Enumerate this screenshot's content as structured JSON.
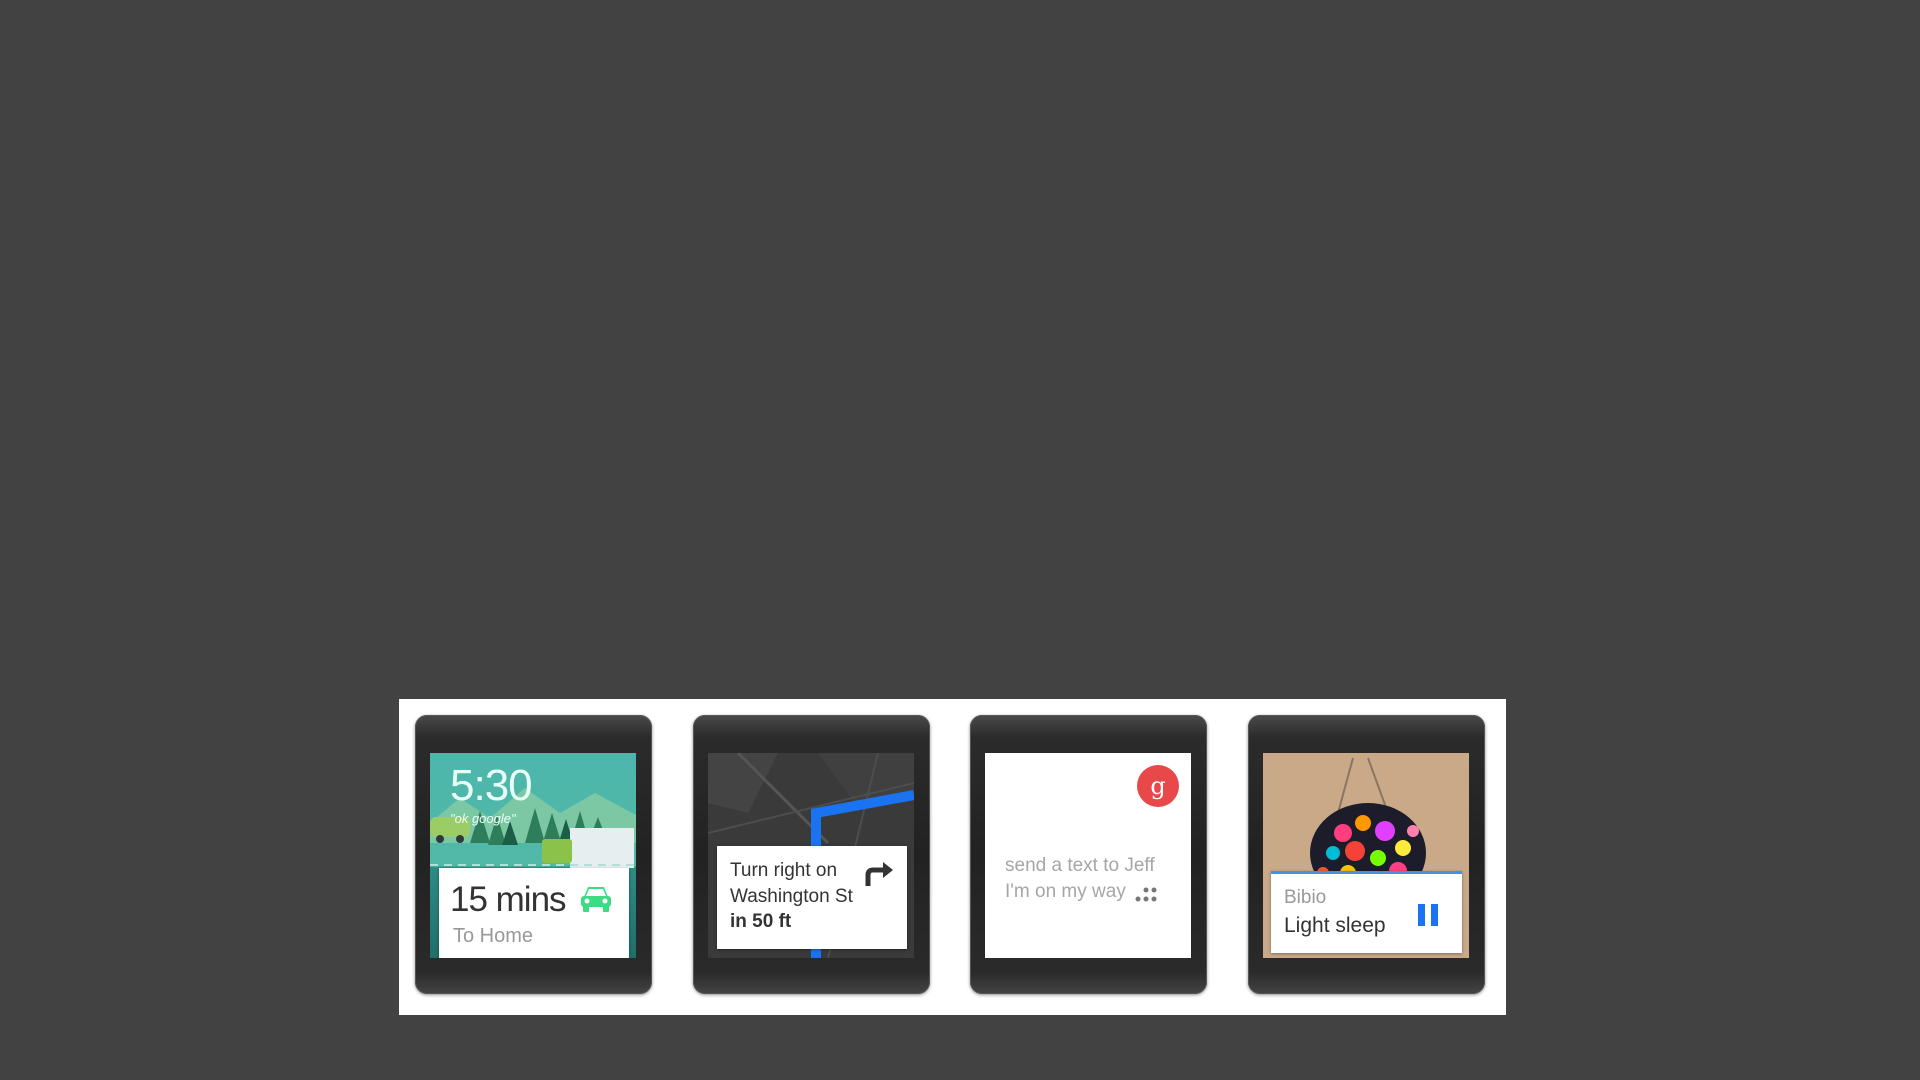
{
  "watches": [
    {
      "time": "5:30",
      "hint": "\"ok google\"",
      "card": {
        "primary": "15 mins",
        "secondary": "To Home"
      },
      "icon": "car-icon",
      "icon_color": "#3ddc84"
    },
    {
      "card": {
        "line1": "Turn right on",
        "line2": "Washington St",
        "line3": "in 50 ft"
      },
      "icon": "turn-right-arrow-icon",
      "route_color": "#1a73f0"
    },
    {
      "button": "g",
      "query": {
        "line1": "send a text to Jeff",
        "line2": "I'm on my way"
      },
      "icon": "google-mic-button-icon",
      "accent": "#e8484a"
    },
    {
      "card": {
        "artist": "Bibio",
        "track": "Light sleep"
      },
      "icon": "pause-icon",
      "accent": "#1a73f0"
    }
  ]
}
